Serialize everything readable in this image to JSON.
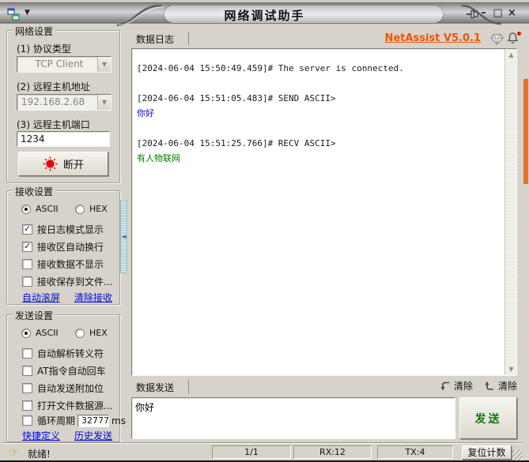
{
  "window": {
    "title": "网络调试助手",
    "controls": {
      "minimize": "–",
      "maximize": "□",
      "close": "×"
    }
  },
  "icons": {
    "menu_caret": "▼",
    "dropdown": "▼",
    "splitter_collapse": "◄",
    "scroll_up": "▲",
    "scroll_down": "▼",
    "ready_hand": "☞"
  },
  "colors": {
    "brand_orange": "#f25305",
    "link_blue": "#0008e0",
    "send_text_blue": "#0000e0",
    "recv_text_green": "#008000",
    "send_button_green": "#0a7a0a",
    "disconnect_light_red": "#e60000",
    "frame_indicator_orange": "#e0722c"
  },
  "network_settings": {
    "title": "网络设置",
    "protocol_label": "(1) 协议类型",
    "protocol_value": "TCP Client",
    "host_label": "(2) 远程主机地址",
    "host_value": "192.168.2.68",
    "port_label": "(3) 远程主机端口",
    "port_value": "1234",
    "disconnect_label": "断开"
  },
  "recv_settings": {
    "title": "接收设置",
    "radio_ascii": "ASCII",
    "radio_hex": "HEX",
    "ascii_selected": true,
    "checkboxes": [
      {
        "label": "按日志模式显示",
        "checked": true
      },
      {
        "label": "接收区自动换行",
        "checked": true
      },
      {
        "label": "接收数据不显示",
        "checked": false
      },
      {
        "label": "接收保存到文件...",
        "checked": false
      }
    ],
    "links": [
      "自动滚屏",
      "清除接收"
    ]
  },
  "send_settings": {
    "title": "发送设置",
    "radio_ascii": "ASCII",
    "radio_hex": "HEX",
    "ascii_selected": true,
    "checkboxes": [
      {
        "label": "自动解析转义符",
        "checked": false
      },
      {
        "label": "AT指令自动回车",
        "checked": false
      },
      {
        "label": "自动发送附加位",
        "checked": false
      },
      {
        "label": "打开文件数据源...",
        "checked": false
      },
      {
        "label": "循环周期",
        "checked": false
      }
    ],
    "period_value": "32777",
    "period_unit": "ms",
    "links": [
      "快捷定义",
      "历史发送"
    ]
  },
  "log_panel": {
    "tab": "数据日志",
    "brand": "NetAssist V5.0.1",
    "entries": [
      {
        "line": "[2024-06-04 15:50:49.459]# The server is connected.",
        "payload": ""
      },
      {
        "line": "[2024-06-04 15:51:05.483]# SEND ASCII>",
        "payload": "你好"
      },
      {
        "line": "[2024-06-04 15:51:25.766]# RECV ASCII>",
        "payload": "有人物联网"
      }
    ]
  },
  "send_panel": {
    "tab": "数据发送",
    "clear_recv_label": "清除",
    "clear_send_label": "清除",
    "input_value": "你好",
    "send_label": "发送"
  },
  "status_bar": {
    "ready": "就绪!",
    "page": "1/1",
    "rx": "RX:12",
    "tx": "TX:4",
    "reset_label": "复位计数"
  }
}
